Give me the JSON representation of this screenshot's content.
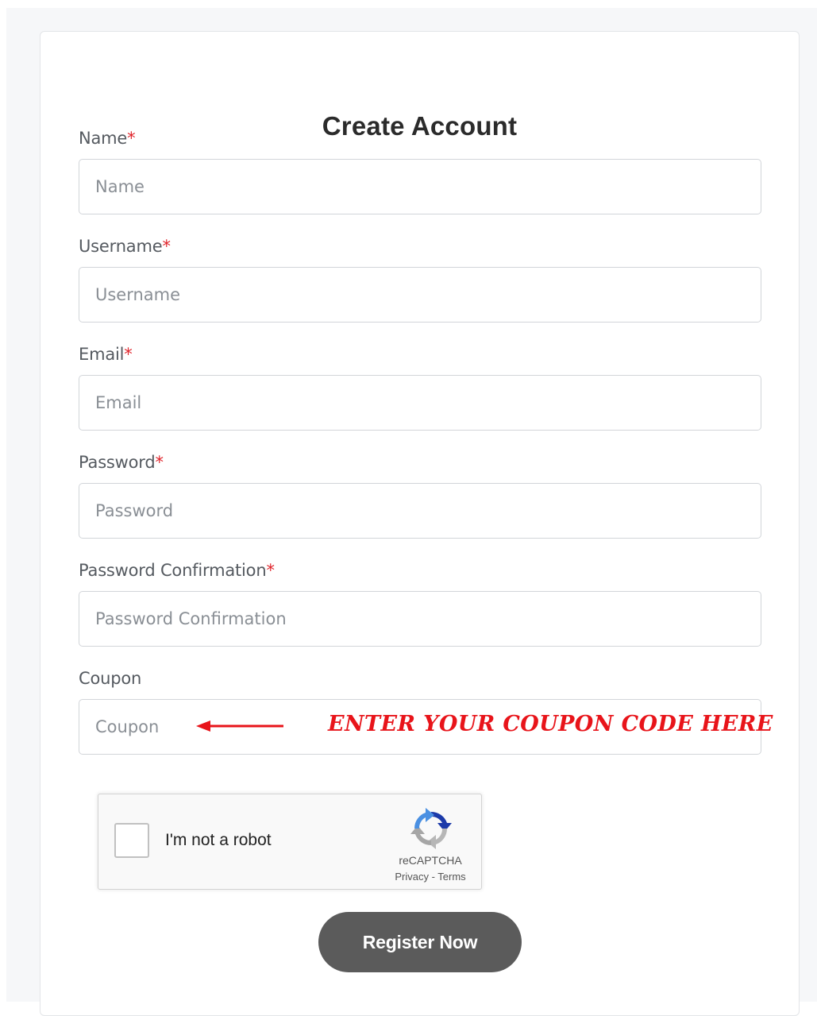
{
  "form": {
    "title": "Create Account",
    "required_marker": "*",
    "fields": [
      {
        "label": "Name",
        "placeholder": "Name",
        "required": true
      },
      {
        "label": "Username",
        "placeholder": "Username",
        "required": true
      },
      {
        "label": "Email",
        "placeholder": "Email",
        "required": true
      },
      {
        "label": "Password",
        "placeholder": "Password",
        "required": true
      },
      {
        "label": "Password Confirmation",
        "placeholder": "Password Confirmation",
        "required": true
      },
      {
        "label": "Coupon",
        "placeholder": "Coupon",
        "required": false
      }
    ],
    "submit_label": "Register Now"
  },
  "annotation": {
    "text": "ENTER YOUR COUPON CODE HERE",
    "color": "#e8141a",
    "icon": "arrow-left-icon"
  },
  "recaptcha": {
    "label": "I'm not a robot",
    "brand": "reCAPTCHA",
    "privacy": "Privacy",
    "separator": " - ",
    "terms": "Terms",
    "icon": "recaptcha-logo-icon"
  },
  "colors": {
    "required": "#e0242b",
    "button_bg": "#5b5b5b",
    "page_bg": "#f6f7f9"
  }
}
